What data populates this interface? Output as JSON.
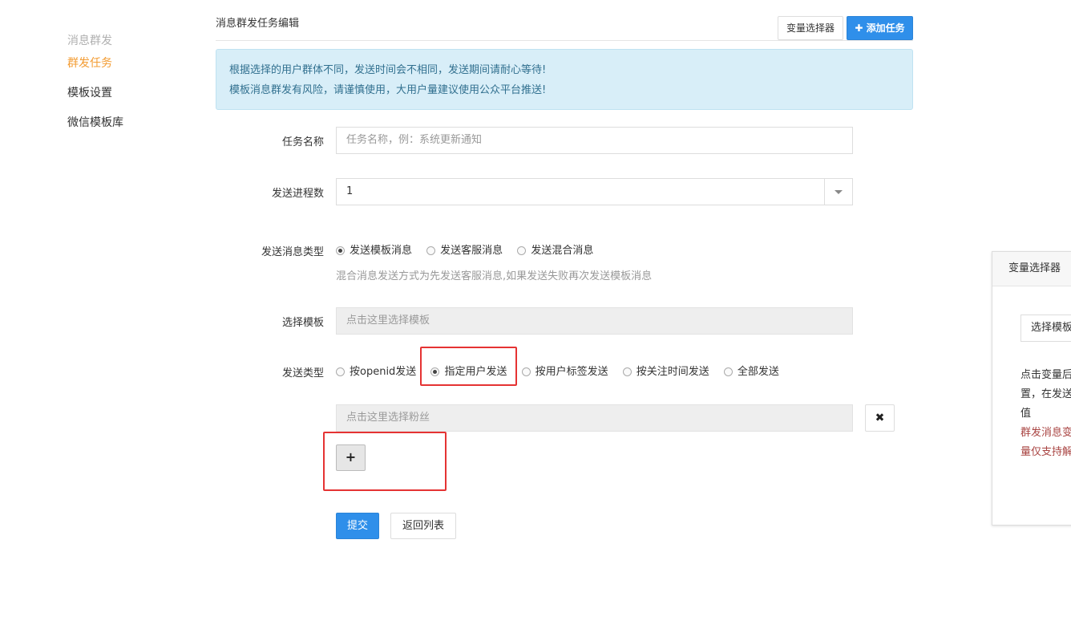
{
  "sidebar": {
    "group_title": "消息群发",
    "items": [
      {
        "label": "群发任务",
        "active": true
      },
      {
        "label": "模板设置",
        "active": false
      },
      {
        "label": "微信模板库",
        "active": false
      }
    ]
  },
  "header": {
    "title": "消息群发任务编辑",
    "variable_button": "变量选择器",
    "add_task_button": "✚ 添加任务"
  },
  "alert": {
    "line1": "根据选择的用户群体不同，发送时间会不相同，发送期间请耐心等待!",
    "line2": "模板消息群发有风险，请谨慎使用，大用户量建议使用公众平台推送!"
  },
  "form": {
    "task_name": {
      "label": "任务名称",
      "placeholder": "任务名称，例：系统更新通知",
      "value": ""
    },
    "process_count": {
      "label": "发送进程数",
      "value": "1"
    },
    "message_type": {
      "label": "发送消息类型",
      "options": [
        "发送模板消息",
        "发送客服消息",
        "发送混合消息"
      ],
      "selected": "发送模板消息",
      "help": "混合消息发送方式为先发送客服消息,如果发送失败再次发送模板消息"
    },
    "template": {
      "label": "选择模板",
      "placeholder": "点击这里选择模板"
    },
    "send_type": {
      "label": "发送类型",
      "options": [
        "按openid发送",
        "指定用户发送",
        "按用户标签发送",
        "按关注时间发送",
        "全部发送"
      ],
      "selected": "指定用户发送"
    },
    "fans": {
      "placeholder": "点击这里选择粉丝"
    },
    "remove_icon": "✖",
    "add_icon": "+",
    "submit_button": "提交",
    "back_button": "返回列表"
  },
  "panel": {
    "title": "变量选择器",
    "select_placeholder": "选择模板",
    "desc_lines": [
      "点击变量后",
      "置，在发送",
      "值"
    ],
    "warn_lines": [
      "群发消息变",
      "量仅支持解"
    ]
  },
  "colors": {
    "accent_orange": "#f39c33",
    "primary_blue": "#2f8fea",
    "alert_bg": "#d8eef8",
    "alert_text": "#31708f",
    "highlight_red": "#e53333",
    "warn_text": "#a94442"
  }
}
